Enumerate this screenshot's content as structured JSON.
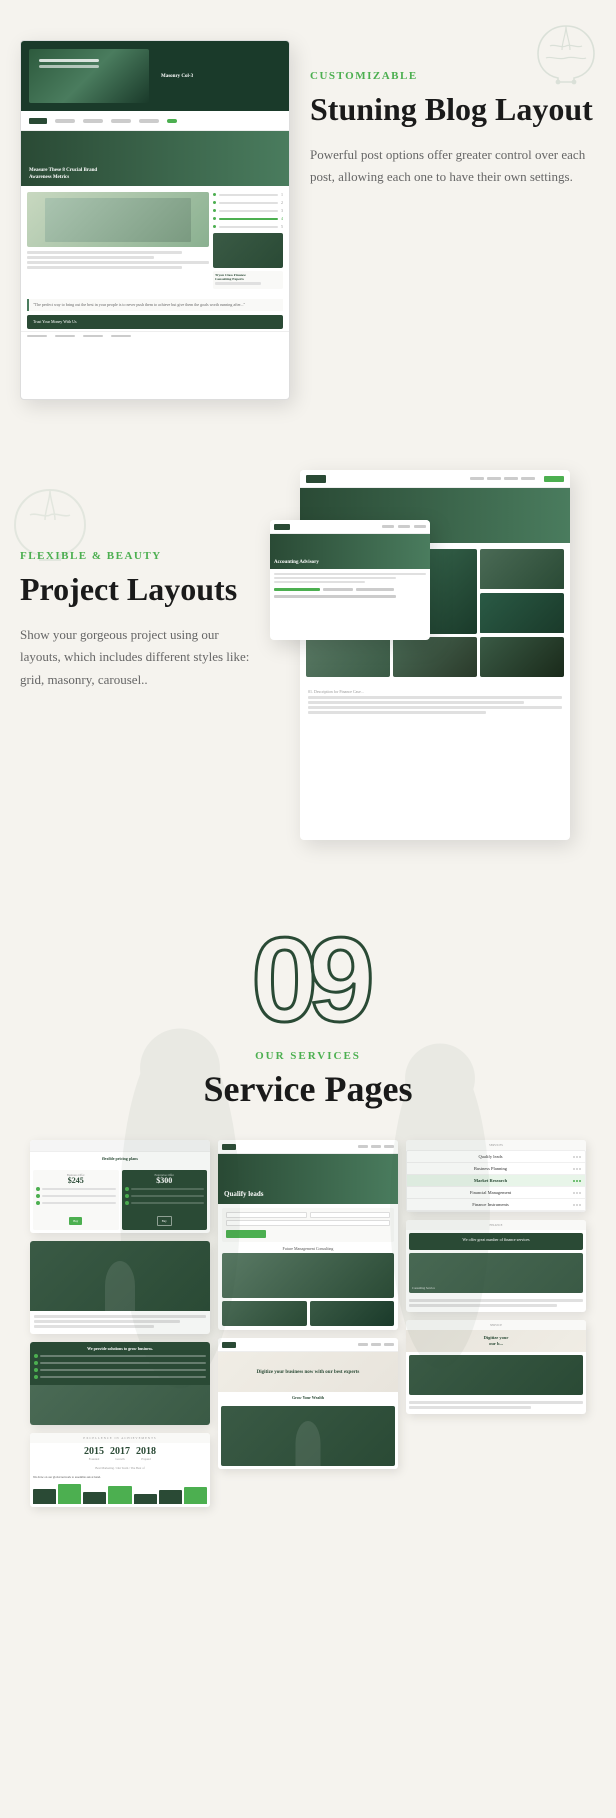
{
  "section_blog": {
    "label": "CUSTOMIZABLE",
    "title": "Stuning Blog Layout",
    "description": "Powerful post options offer greater control over each post, allowing each one to have their own settings.",
    "screenshot_alt": "Blog layout screenshot"
  },
  "section_project": {
    "label": "FLEXIBLE & BEAUTY",
    "title": "Project Layouts",
    "description": "Show your gorgeous project using our layouts, which includes different styles like: grid, masonry, carousel..",
    "screenshot_alt": "Project layout screenshot"
  },
  "section_services": {
    "number": "09",
    "label": "OUR SERVICES",
    "title": "Service Pages"
  },
  "service_screens": {
    "pricing_title": "flexible pricing plans",
    "business_offer": "Business Offer",
    "enterprise_offer": "Enterprise Offer",
    "price1": "$245",
    "price2": "$300",
    "qualify_leads": "Qualify leads",
    "future_consulting": "Future Management Consulting",
    "digitize_title": "Digitize your business now with our best experts",
    "grow_title": "We provide solutions to grow business.",
    "qualify_list": [
      "Qualify leads",
      "Business Planning",
      "Market Research",
      "Financial Management",
      "Finance Instruments"
    ],
    "offer_text": "We offer great number of finance services",
    "consulting_label": "Consulting Service",
    "digitize_bottom": "Digitize your business now with our best experts",
    "grow_wealth": "Grow Your Wealth",
    "excellence": "excellence in achievements",
    "year1": "2015",
    "year2": "2017",
    "year3": "2018"
  }
}
